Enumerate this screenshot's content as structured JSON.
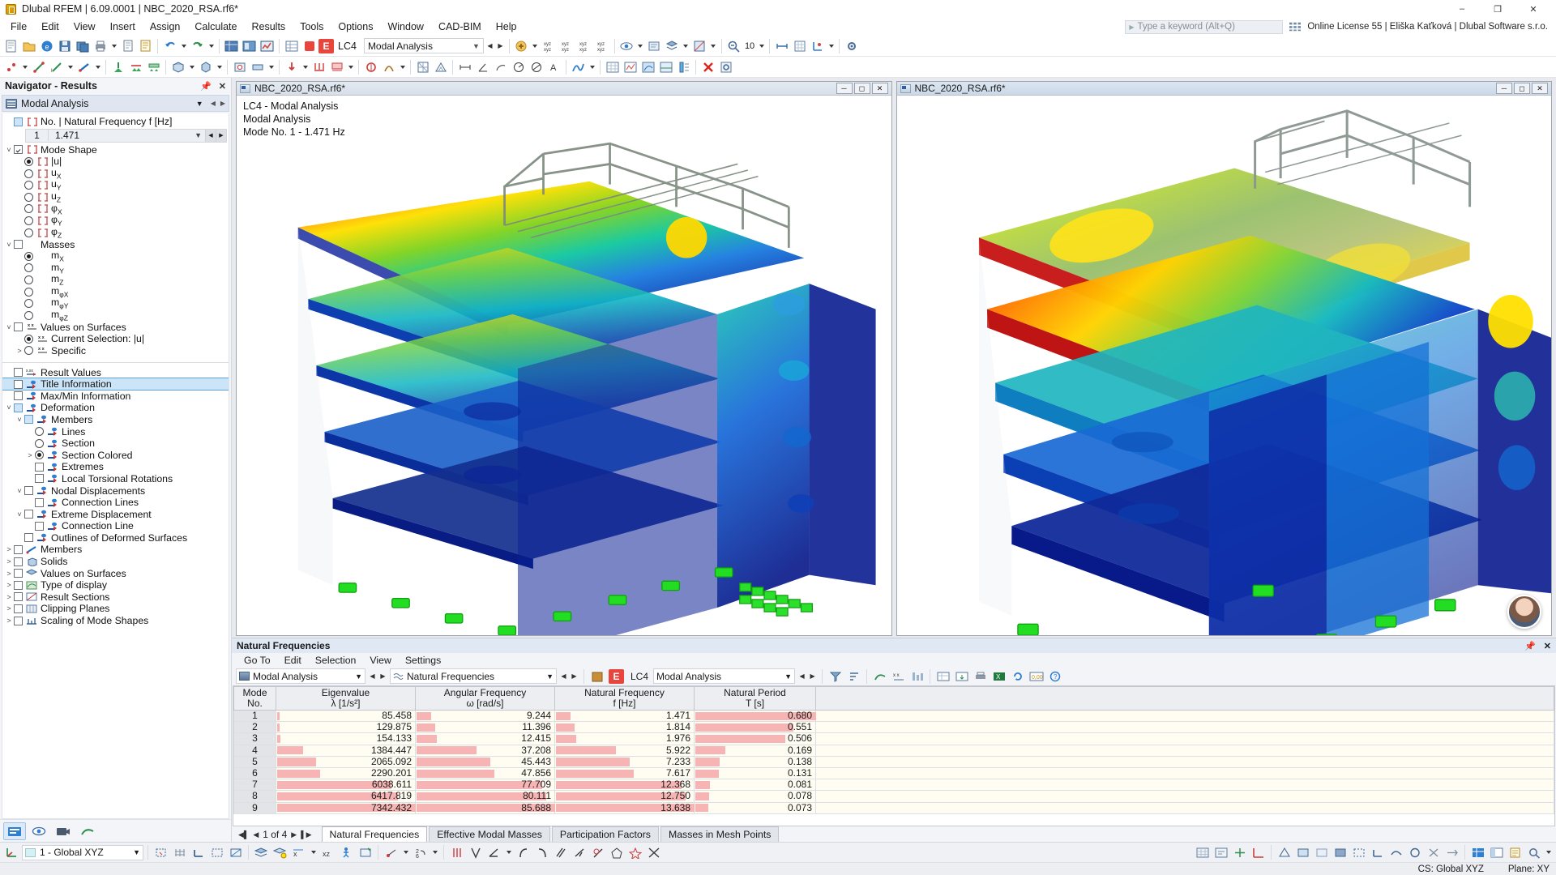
{
  "titlebar": {
    "title": "Dlubal RFEM | 6.09.0001 | NBC_2020_RSA.rf6*",
    "minimize": "–",
    "maximize": "❐",
    "close": "✕"
  },
  "menubar": {
    "items": [
      "File",
      "Edit",
      "View",
      "Insert",
      "Assign",
      "Calculate",
      "Results",
      "Tools",
      "Options",
      "Window",
      "CAD-BIM",
      "Help"
    ],
    "search_placeholder": "Type a keyword (Alt+Q)",
    "license": "Online License 55 | Eliška Kaťková | Dlubal Software s.r.o."
  },
  "toolbar": {
    "lc_badge": "E",
    "lc_label": "LC4",
    "lc_select_value": "Modal Analysis",
    "zoom_value": "10"
  },
  "navigator": {
    "header": "Navigator - Results",
    "combo_value": "Modal Analysis",
    "frequency_node": "No. | Natural Frequency f [Hz]",
    "frequency_no": "1",
    "frequency_value": "1.471",
    "tree": [
      {
        "label": "Mode Shape",
        "indent": 0,
        "ctl": "check-on",
        "twisty": "down",
        "icon": "mode-shape-icon"
      },
      {
        "label": "|u|",
        "indent": 1,
        "ctl": "radio-on",
        "twisty": "none",
        "icon": "mode-shape-icon"
      },
      {
        "label": "u",
        "sub": "X",
        "indent": 1,
        "ctl": "radio",
        "twisty": "none",
        "icon": "mode-shape-icon"
      },
      {
        "label": "u",
        "sub": "Y",
        "indent": 1,
        "ctl": "radio",
        "twisty": "none",
        "icon": "mode-shape-icon"
      },
      {
        "label": "u",
        "sub": "Z",
        "indent": 1,
        "ctl": "radio",
        "twisty": "none",
        "icon": "mode-shape-icon"
      },
      {
        "label": "φ",
        "sub": "X",
        "indent": 1,
        "ctl": "radio",
        "twisty": "none",
        "icon": "mode-shape-icon"
      },
      {
        "label": "φ",
        "sub": "Y",
        "indent": 1,
        "ctl": "radio",
        "twisty": "none",
        "icon": "mode-shape-icon"
      },
      {
        "label": "φ",
        "sub": "Z",
        "indent": 1,
        "ctl": "radio",
        "twisty": "none",
        "icon": "mode-shape-icon"
      },
      {
        "label": "Masses",
        "indent": 0,
        "ctl": "check",
        "twisty": "down",
        "icon": "none"
      },
      {
        "label": "m",
        "sub": "X",
        "indent": 1,
        "ctl": "radio-on",
        "twisty": "none",
        "icon": "none"
      },
      {
        "label": "m",
        "sub": "Y",
        "indent": 1,
        "ctl": "radio",
        "twisty": "none",
        "icon": "none"
      },
      {
        "label": "m",
        "sub": "Z",
        "indent": 1,
        "ctl": "radio",
        "twisty": "none",
        "icon": "none"
      },
      {
        "label": "m",
        "sub": "φX",
        "indent": 1,
        "ctl": "radio",
        "twisty": "none",
        "icon": "none"
      },
      {
        "label": "m",
        "sub": "φY",
        "indent": 1,
        "ctl": "radio",
        "twisty": "none",
        "icon": "none"
      },
      {
        "label": "m",
        "sub": "φZ",
        "indent": 1,
        "ctl": "radio",
        "twisty": "none",
        "icon": "none"
      },
      {
        "label": "Values on Surfaces",
        "indent": 0,
        "ctl": "check",
        "twisty": "down",
        "icon": "xx-icon"
      },
      {
        "label": "Current Selection: |u|",
        "indent": 1,
        "ctl": "radio-on",
        "twisty": "none",
        "icon": "xx-icon"
      },
      {
        "label": "Specific",
        "indent": 1,
        "ctl": "radio",
        "twisty": "right",
        "icon": "xx-icon"
      }
    ],
    "tree2": [
      {
        "label": "Result Values",
        "indent": 0,
        "ctl": "check",
        "twisty": "none",
        "icon": "xxx-icon",
        "sel": false
      },
      {
        "label": "Title Information",
        "indent": 0,
        "ctl": "check",
        "twisty": "none",
        "icon": "info-icon",
        "sel": true
      },
      {
        "label": "Max/Min Information",
        "indent": 0,
        "ctl": "check",
        "twisty": "none",
        "icon": "info-icon",
        "sel": false
      },
      {
        "label": "Deformation",
        "indent": 0,
        "ctl": "check-partial",
        "twisty": "down",
        "icon": "info-icon",
        "sel": false
      },
      {
        "label": "Members",
        "indent": 1,
        "ctl": "check-partial",
        "twisty": "down",
        "icon": "info-icon",
        "sel": false
      },
      {
        "label": "Lines",
        "indent": 2,
        "ctl": "radio",
        "twisty": "none",
        "icon": "info-icon",
        "sel": false
      },
      {
        "label": "Section",
        "indent": 2,
        "ctl": "radio",
        "twisty": "none",
        "icon": "info-icon",
        "sel": false
      },
      {
        "label": "Section Colored",
        "indent": 2,
        "ctl": "radio-on",
        "twisty": "right",
        "icon": "info-icon",
        "sel": false
      },
      {
        "label": "Extremes",
        "indent": 2,
        "ctl": "check",
        "twisty": "none",
        "icon": "info-icon",
        "sel": false
      },
      {
        "label": "Local Torsional Rotations",
        "indent": 2,
        "ctl": "check",
        "twisty": "none",
        "icon": "info-icon",
        "sel": false
      },
      {
        "label": "Nodal Displacements",
        "indent": 1,
        "ctl": "check",
        "twisty": "down",
        "icon": "info-icon",
        "sel": false
      },
      {
        "label": "Connection Lines",
        "indent": 2,
        "ctl": "check",
        "twisty": "none",
        "icon": "info-icon",
        "sel": false
      },
      {
        "label": "Extreme Displacement",
        "indent": 1,
        "ctl": "check",
        "twisty": "down",
        "icon": "info-icon",
        "sel": false
      },
      {
        "label": "Connection Line",
        "indent": 2,
        "ctl": "check",
        "twisty": "none",
        "icon": "info-icon",
        "sel": false
      },
      {
        "label": "Outlines of Deformed Surfaces",
        "indent": 1,
        "ctl": "check",
        "twisty": "none",
        "icon": "info-icon",
        "sel": false
      },
      {
        "label": "Members",
        "indent": 0,
        "ctl": "check",
        "twisty": "right",
        "icon": "member-icon",
        "sel": false
      },
      {
        "label": "Solids",
        "indent": 0,
        "ctl": "check",
        "twisty": "right",
        "icon": "solid-icon",
        "sel": false
      },
      {
        "label": "Values on Surfaces",
        "indent": 0,
        "ctl": "check",
        "twisty": "right",
        "icon": "surface-icon",
        "sel": false
      },
      {
        "label": "Type of display",
        "indent": 0,
        "ctl": "check",
        "twisty": "right",
        "icon": "display-icon",
        "sel": false
      },
      {
        "label": "Result Sections",
        "indent": 0,
        "ctl": "check",
        "twisty": "right",
        "icon": "section-icon",
        "sel": false
      },
      {
        "label": "Clipping Planes",
        "indent": 0,
        "ctl": "check",
        "twisty": "right",
        "icon": "clip-icon",
        "sel": false
      },
      {
        "label": "Scaling of Mode Shapes",
        "indent": 0,
        "ctl": "check",
        "twisty": "right",
        "icon": "scale-icon",
        "sel": false
      }
    ]
  },
  "viewports": [
    {
      "title": "NBC_2020_RSA.rf6*",
      "caption_lines": [
        "LC4 - Modal Analysis",
        "Modal Analysis",
        "Mode No. 1 - 1.471 Hz"
      ],
      "active": false
    },
    {
      "title": "NBC_2020_RSA.rf6*",
      "caption_lines": [],
      "active": true
    }
  ],
  "results": {
    "panel_title": "Natural Frequencies",
    "menu": [
      "Go To",
      "Edit",
      "Selection",
      "View",
      "Settings"
    ],
    "combo_left": "Modal Analysis",
    "combo_mid": "Natural Frequencies",
    "lc_badge": "E",
    "lc_label": "LC4",
    "combo_right": "Modal Analysis",
    "columns": [
      {
        "line1": "Mode",
        "line2": "No."
      },
      {
        "line1": "Eigenvalue",
        "line2": "λ [1/s²]"
      },
      {
        "line1": "Angular Frequency",
        "line2": "ω [rad/s]"
      },
      {
        "line1": "Natural Frequency",
        "line2": "f [Hz]"
      },
      {
        "line1": "Natural Period",
        "line2": "T [s]"
      }
    ],
    "rows": [
      {
        "mode": "1",
        "eigenvalue": "85.458",
        "omega": "9.244",
        "freq": "1.471",
        "period": "0.680"
      },
      {
        "mode": "2",
        "eigenvalue": "129.875",
        "omega": "11.396",
        "freq": "1.814",
        "period": "0.551"
      },
      {
        "mode": "3",
        "eigenvalue": "154.133",
        "omega": "12.415",
        "freq": "1.976",
        "period": "0.506"
      },
      {
        "mode": "4",
        "eigenvalue": "1384.447",
        "omega": "37.208",
        "freq": "5.922",
        "period": "0.169"
      },
      {
        "mode": "5",
        "eigenvalue": "2065.092",
        "omega": "45.443",
        "freq": "7.233",
        "period": "0.138"
      },
      {
        "mode": "6",
        "eigenvalue": "2290.201",
        "omega": "47.856",
        "freq": "7.617",
        "period": "0.131"
      },
      {
        "mode": "7",
        "eigenvalue": "6038.611",
        "omega": "77.709",
        "freq": "12.368",
        "period": "0.081"
      },
      {
        "mode": "8",
        "eigenvalue": "6417.819",
        "omega": "80.111",
        "freq": "12.750",
        "period": "0.078"
      },
      {
        "mode": "9",
        "eigenvalue": "7342.432",
        "omega": "85.688",
        "freq": "13.638",
        "period": "0.073"
      }
    ],
    "pager": "1 of 4",
    "tabs": [
      {
        "label": "Natural Frequencies",
        "active": true
      },
      {
        "label": "Effective Modal Masses",
        "active": false
      },
      {
        "label": "Participation Factors",
        "active": false
      },
      {
        "label": "Masses in Mesh Points",
        "active": false
      }
    ]
  },
  "statusbar": {
    "cs_combo": "1 - Global XYZ",
    "cs_text": "CS: Global XYZ",
    "plane_text": "Plane: XY"
  },
  "chart_data": {
    "type": "bar",
    "title": "Natural Frequencies",
    "categories": [
      "1",
      "2",
      "3",
      "4",
      "5",
      "6",
      "7",
      "8",
      "9"
    ],
    "series": [
      {
        "name": "Eigenvalue λ [1/s²]",
        "values": [
          85.458,
          129.875,
          154.133,
          1384.447,
          2065.092,
          2290.201,
          6038.611,
          6417.819,
          7342.432
        ]
      },
      {
        "name": "Angular Frequency ω [rad/s]",
        "values": [
          9.244,
          11.396,
          12.415,
          37.208,
          45.443,
          47.856,
          77.709,
          80.111,
          85.688
        ]
      },
      {
        "name": "Natural Frequency f [Hz]",
        "values": [
          1.471,
          1.814,
          1.976,
          5.922,
          7.233,
          7.617,
          12.368,
          12.75,
          13.638
        ]
      },
      {
        "name": "Natural Period T [s]",
        "values": [
          0.68,
          0.551,
          0.506,
          0.169,
          0.138,
          0.131,
          0.081,
          0.078,
          0.073
        ]
      }
    ],
    "xlabel": "Mode No.",
    "ylabel": "",
    "grid": false,
    "legend": "none"
  }
}
